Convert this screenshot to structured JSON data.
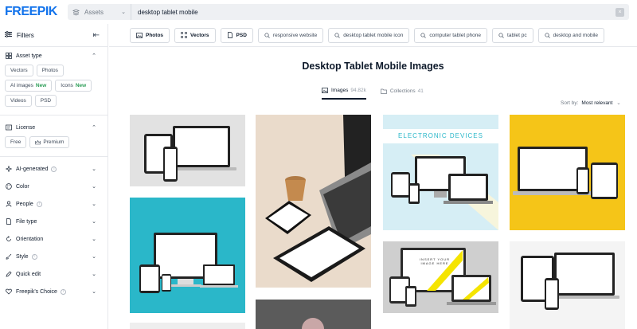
{
  "header": {
    "logo": "FREEPIK",
    "assets_dropdown": "Assets",
    "search_value": "desktop tablet mobile"
  },
  "sidebar": {
    "title": "Filters",
    "asset_type": {
      "title": "Asset type",
      "chips": [
        {
          "label": "Vectors"
        },
        {
          "label": "Photos"
        },
        {
          "label": "AI images",
          "badge": "New"
        },
        {
          "label": "Icons",
          "badge": "New"
        },
        {
          "label": "Videos"
        },
        {
          "label": "PSD"
        }
      ]
    },
    "license": {
      "title": "License",
      "chips": [
        {
          "label": "Free"
        },
        {
          "label": "Premium"
        }
      ]
    },
    "sections": [
      {
        "title": "AI-generated",
        "info": true
      },
      {
        "title": "Color"
      },
      {
        "title": "People",
        "info": true
      },
      {
        "title": "File type"
      },
      {
        "title": "Orientation"
      },
      {
        "title": "Style",
        "info": true
      },
      {
        "title": "Quick edit"
      },
      {
        "title": "Freepik's Choice",
        "info": true
      }
    ]
  },
  "tags": [
    {
      "label": "Photos",
      "icon": "photo-icon",
      "bold": true
    },
    {
      "label": "Vectors",
      "icon": "vector-icon",
      "bold": true
    },
    {
      "label": "PSD",
      "icon": "psd-icon",
      "bold": true
    },
    {
      "label": "responsive website",
      "icon": "search-icon"
    },
    {
      "label": "desktop tablet mobile icon",
      "icon": "search-icon"
    },
    {
      "label": "computer tablet phone",
      "icon": "search-icon"
    },
    {
      "label": "tablet pc",
      "icon": "search-icon"
    },
    {
      "label": "desktop and mobile",
      "icon": "search-icon"
    }
  ],
  "main": {
    "title": "Desktop Tablet Mobile Images",
    "tabs": [
      {
        "label": "Images",
        "count": "94.82k",
        "active": true
      },
      {
        "label": "Collections",
        "count": "41"
      }
    ],
    "sort_label": "Sort by:",
    "sort_value": "Most relevant",
    "thumb_text": "ELECTRONIC DEVICES",
    "thumb_text2": "INSERT YOUR IMAGE HERE"
  },
  "colors": {
    "brand": "#1273eb",
    "new_badge": "#2e9e58",
    "teal_bg": "#2ab7c9",
    "yellow_bg": "#f5c518",
    "light_blue_bg": "#d6eef5"
  }
}
